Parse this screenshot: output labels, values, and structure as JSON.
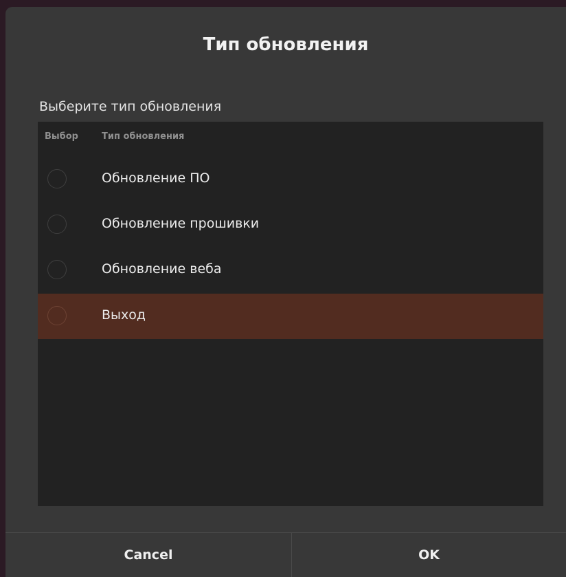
{
  "dialog": {
    "title": "Тип обновления",
    "prompt": "Выберите тип обновления"
  },
  "list": {
    "columns": {
      "select": "Выбор",
      "type": "Тип обновления"
    },
    "rows": [
      {
        "label": "Обновление ПО",
        "selected": false
      },
      {
        "label": "Обновление прошивки",
        "selected": false
      },
      {
        "label": "Обновление веба",
        "selected": false
      },
      {
        "label": "Выход",
        "selected": true
      }
    ],
    "highlight_color": "#522c20"
  },
  "buttons": {
    "cancel": "Cancel",
    "ok": "OK"
  }
}
